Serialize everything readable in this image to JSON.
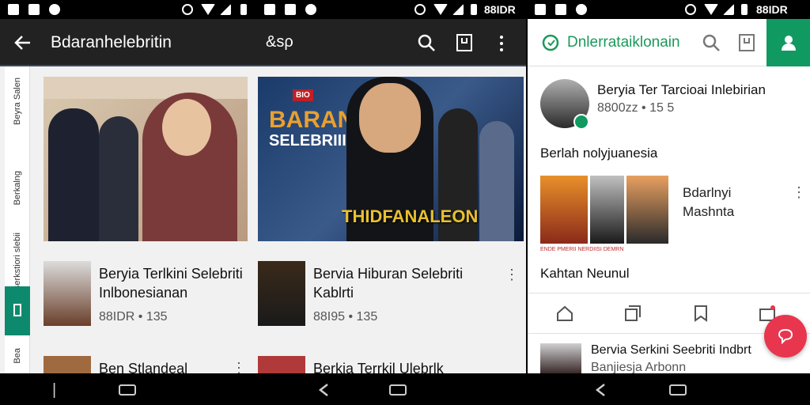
{
  "status": {
    "left_carrier": "",
    "right_label": "88IDR",
    "mid_label": "88IDR"
  },
  "appbar": {
    "title": "Bdaranhelebritin",
    "logo": "&sρ"
  },
  "rail": {
    "labels": [
      "Beyra Salen",
      "Berkalng",
      "Berkstiori slebii",
      "Bea"
    ]
  },
  "hero": {
    "left_alt": "",
    "right_badge": "BIO",
    "right_title1": "BARAN",
    "right_title2": "SELEBRIII",
    "right_caption": "THIDFANALEON"
  },
  "cards": [
    {
      "line1": "Beryia Terlkini Selebriti",
      "line2": "Inlbonesianan",
      "meta": "88IDR • 135"
    },
    {
      "line1": "Bervia Hiburan Selebriti",
      "line2": "Kablrti",
      "meta": "88I95 • 135"
    },
    {
      "line1": "Ben Stlandeal",
      "line2": "",
      "meta": ""
    },
    {
      "line1": "Berkia Terrkil Ulebrlk",
      "line2": "",
      "meta": ""
    }
  ],
  "rbar": {
    "title": "Dnlerrataiklonain"
  },
  "profile": {
    "name": "Beryia Ter Tarcioai Inlebirian",
    "meta": "8800zz • 15 5"
  },
  "section1": {
    "title": "Berlah nolyjuanesia"
  },
  "gallery": {
    "label1": "Bdarlnyi",
    "label2": "Mashnta",
    "caption": "ENDE PMERII NERDIISI DEMRN"
  },
  "section2": {
    "title": "Kahtan Neunul"
  },
  "bottom_tabs": [
    "home-icon",
    "copy-icon",
    "bookmark-icon",
    "inbox-icon"
  ],
  "bottom_item": {
    "line1": "Bervia Serkini Seebriti Indbrt",
    "line2": "Banjiesja Arbonn"
  },
  "colors": {
    "accent": "#0d8a6e",
    "brand_green": "#109a62",
    "fab": "#e8364f",
    "appbar_dark": "#222222"
  }
}
